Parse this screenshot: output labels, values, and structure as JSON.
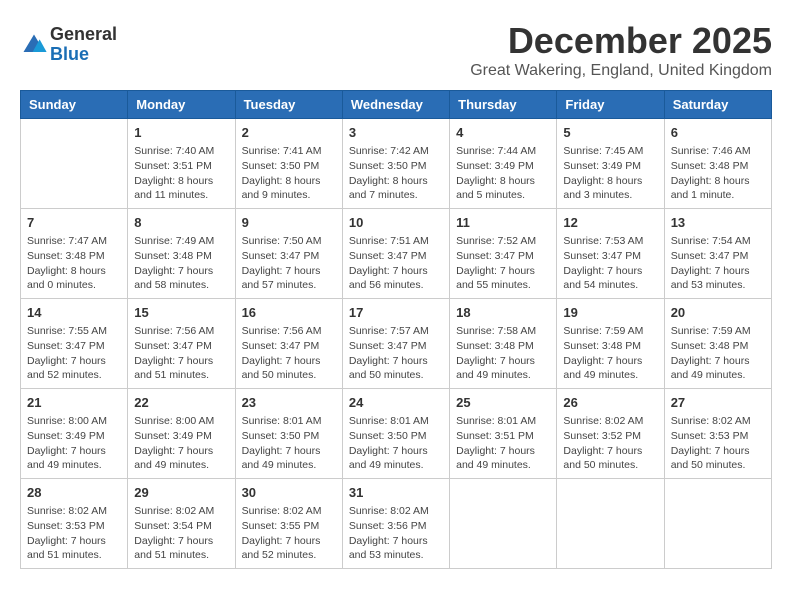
{
  "header": {
    "logo_line1": "General",
    "logo_line2": "Blue",
    "month": "December 2025",
    "location": "Great Wakering, England, United Kingdom"
  },
  "days_of_week": [
    "Sunday",
    "Monday",
    "Tuesday",
    "Wednesday",
    "Thursday",
    "Friday",
    "Saturday"
  ],
  "weeks": [
    [
      {
        "day": "",
        "info": ""
      },
      {
        "day": "1",
        "info": "Sunrise: 7:40 AM\nSunset: 3:51 PM\nDaylight: 8 hours\nand 11 minutes."
      },
      {
        "day": "2",
        "info": "Sunrise: 7:41 AM\nSunset: 3:50 PM\nDaylight: 8 hours\nand 9 minutes."
      },
      {
        "day": "3",
        "info": "Sunrise: 7:42 AM\nSunset: 3:50 PM\nDaylight: 8 hours\nand 7 minutes."
      },
      {
        "day": "4",
        "info": "Sunrise: 7:44 AM\nSunset: 3:49 PM\nDaylight: 8 hours\nand 5 minutes."
      },
      {
        "day": "5",
        "info": "Sunrise: 7:45 AM\nSunset: 3:49 PM\nDaylight: 8 hours\nand 3 minutes."
      },
      {
        "day": "6",
        "info": "Sunrise: 7:46 AM\nSunset: 3:48 PM\nDaylight: 8 hours\nand 1 minute."
      }
    ],
    [
      {
        "day": "7",
        "info": "Sunrise: 7:47 AM\nSunset: 3:48 PM\nDaylight: 8 hours\nand 0 minutes."
      },
      {
        "day": "8",
        "info": "Sunrise: 7:49 AM\nSunset: 3:48 PM\nDaylight: 7 hours\nand 58 minutes."
      },
      {
        "day": "9",
        "info": "Sunrise: 7:50 AM\nSunset: 3:47 PM\nDaylight: 7 hours\nand 57 minutes."
      },
      {
        "day": "10",
        "info": "Sunrise: 7:51 AM\nSunset: 3:47 PM\nDaylight: 7 hours\nand 56 minutes."
      },
      {
        "day": "11",
        "info": "Sunrise: 7:52 AM\nSunset: 3:47 PM\nDaylight: 7 hours\nand 55 minutes."
      },
      {
        "day": "12",
        "info": "Sunrise: 7:53 AM\nSunset: 3:47 PM\nDaylight: 7 hours\nand 54 minutes."
      },
      {
        "day": "13",
        "info": "Sunrise: 7:54 AM\nSunset: 3:47 PM\nDaylight: 7 hours\nand 53 minutes."
      }
    ],
    [
      {
        "day": "14",
        "info": "Sunrise: 7:55 AM\nSunset: 3:47 PM\nDaylight: 7 hours\nand 52 minutes."
      },
      {
        "day": "15",
        "info": "Sunrise: 7:56 AM\nSunset: 3:47 PM\nDaylight: 7 hours\nand 51 minutes."
      },
      {
        "day": "16",
        "info": "Sunrise: 7:56 AM\nSunset: 3:47 PM\nDaylight: 7 hours\nand 50 minutes."
      },
      {
        "day": "17",
        "info": "Sunrise: 7:57 AM\nSunset: 3:47 PM\nDaylight: 7 hours\nand 50 minutes."
      },
      {
        "day": "18",
        "info": "Sunrise: 7:58 AM\nSunset: 3:48 PM\nDaylight: 7 hours\nand 49 minutes."
      },
      {
        "day": "19",
        "info": "Sunrise: 7:59 AM\nSunset: 3:48 PM\nDaylight: 7 hours\nand 49 minutes."
      },
      {
        "day": "20",
        "info": "Sunrise: 7:59 AM\nSunset: 3:48 PM\nDaylight: 7 hours\nand 49 minutes."
      }
    ],
    [
      {
        "day": "21",
        "info": "Sunrise: 8:00 AM\nSunset: 3:49 PM\nDaylight: 7 hours\nand 49 minutes."
      },
      {
        "day": "22",
        "info": "Sunrise: 8:00 AM\nSunset: 3:49 PM\nDaylight: 7 hours\nand 49 minutes."
      },
      {
        "day": "23",
        "info": "Sunrise: 8:01 AM\nSunset: 3:50 PM\nDaylight: 7 hours\nand 49 minutes."
      },
      {
        "day": "24",
        "info": "Sunrise: 8:01 AM\nSunset: 3:50 PM\nDaylight: 7 hours\nand 49 minutes."
      },
      {
        "day": "25",
        "info": "Sunrise: 8:01 AM\nSunset: 3:51 PM\nDaylight: 7 hours\nand 49 minutes."
      },
      {
        "day": "26",
        "info": "Sunrise: 8:02 AM\nSunset: 3:52 PM\nDaylight: 7 hours\nand 50 minutes."
      },
      {
        "day": "27",
        "info": "Sunrise: 8:02 AM\nSunset: 3:53 PM\nDaylight: 7 hours\nand 50 minutes."
      }
    ],
    [
      {
        "day": "28",
        "info": "Sunrise: 8:02 AM\nSunset: 3:53 PM\nDaylight: 7 hours\nand 51 minutes."
      },
      {
        "day": "29",
        "info": "Sunrise: 8:02 AM\nSunset: 3:54 PM\nDaylight: 7 hours\nand 51 minutes."
      },
      {
        "day": "30",
        "info": "Sunrise: 8:02 AM\nSunset: 3:55 PM\nDaylight: 7 hours\nand 52 minutes."
      },
      {
        "day": "31",
        "info": "Sunrise: 8:02 AM\nSunset: 3:56 PM\nDaylight: 7 hours\nand 53 minutes."
      },
      {
        "day": "",
        "info": ""
      },
      {
        "day": "",
        "info": ""
      },
      {
        "day": "",
        "info": ""
      }
    ]
  ]
}
